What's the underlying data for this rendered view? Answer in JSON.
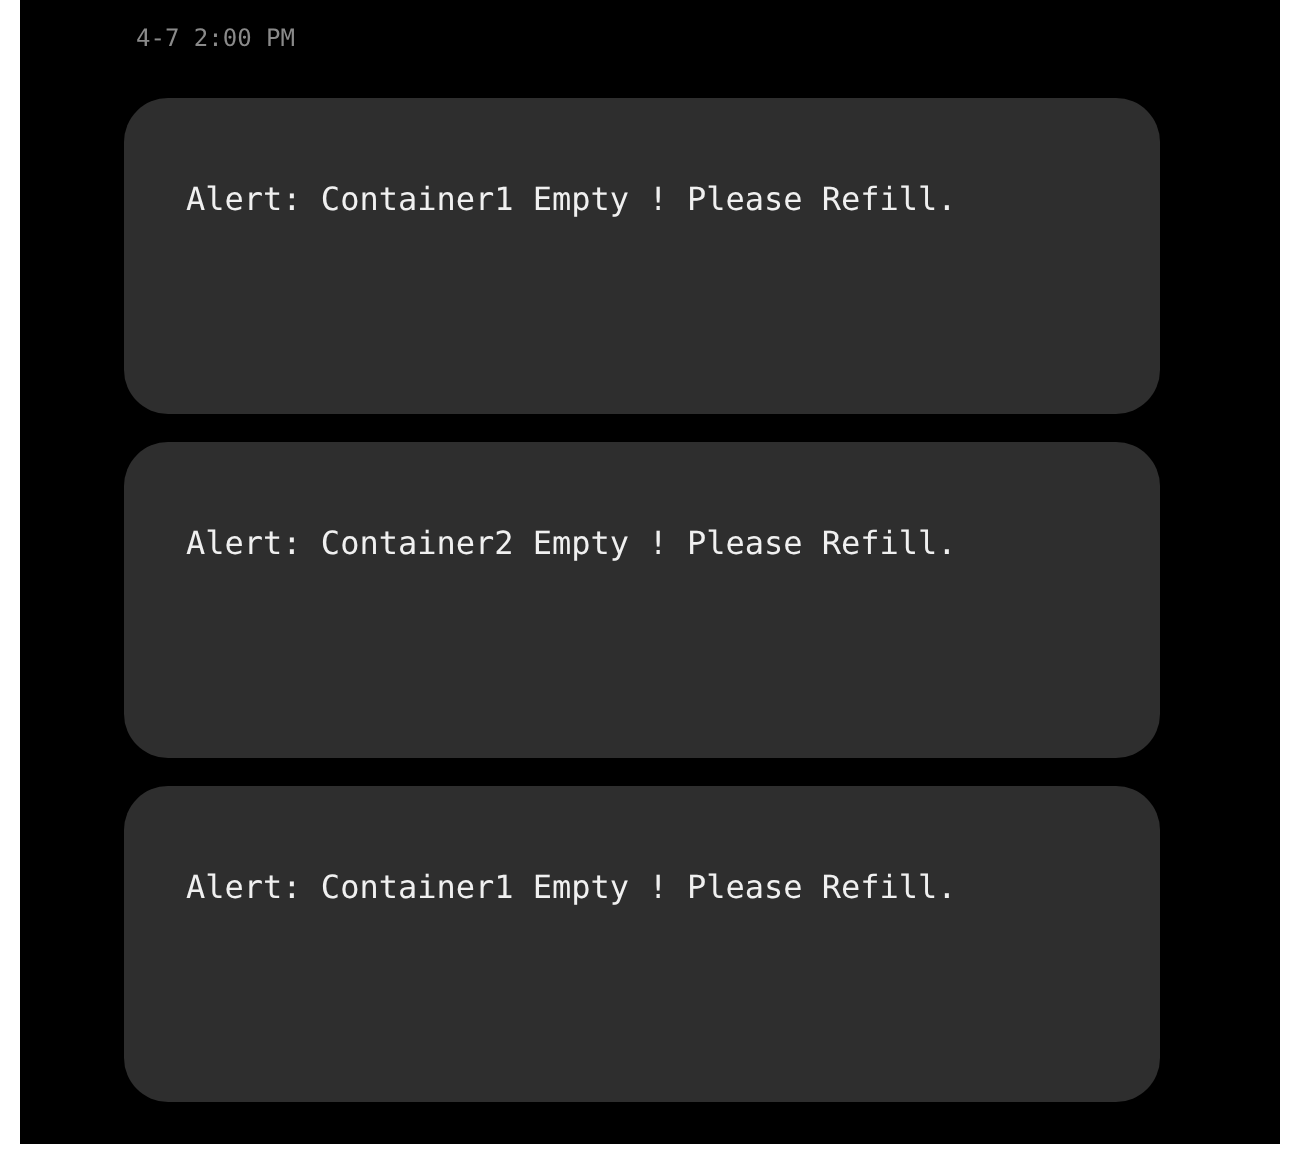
{
  "timestamp": "4-7 2:00 PM",
  "alerts": [
    {
      "message": "Alert: Container1 Empty ! Please Refill."
    },
    {
      "message": "Alert: Container2 Empty ! Please Refill."
    },
    {
      "message": "Alert: Container1 Empty ! Please Refill."
    }
  ]
}
